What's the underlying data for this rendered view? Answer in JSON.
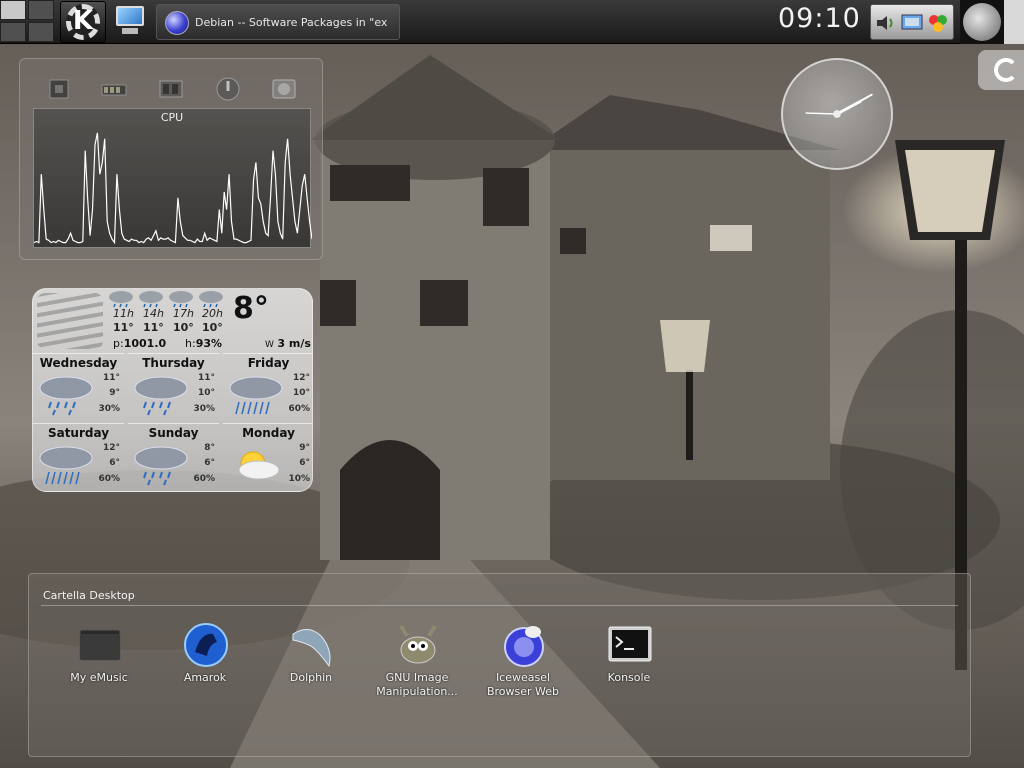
{
  "panel": {
    "taskbar_window_title": "Debian -- Software Packages in \"ex",
    "clock_time": "09:10"
  },
  "system_monitor": {
    "graph_title": "CPU",
    "cpu_samples": [
      2,
      3,
      2,
      60,
      30,
      5,
      4,
      2,
      3,
      2,
      4,
      3,
      2,
      2,
      5,
      10,
      4,
      3,
      2,
      2,
      3,
      80,
      40,
      8,
      30,
      85,
      95,
      60,
      70,
      90,
      20,
      10,
      5,
      2,
      60,
      30,
      10,
      5,
      4,
      3,
      5,
      4,
      4,
      2,
      3,
      2,
      5,
      6,
      4,
      8,
      12,
      4,
      6,
      5,
      5,
      6,
      4,
      3,
      2,
      40,
      20,
      8,
      6,
      4,
      4,
      3,
      2,
      5,
      3,
      3,
      10,
      4,
      6,
      5,
      4,
      3,
      30,
      10,
      45,
      30,
      60,
      20,
      5,
      5,
      4,
      3,
      2,
      2,
      3,
      4,
      55,
      70,
      40,
      35,
      20,
      10,
      8,
      40,
      80,
      60,
      20,
      10,
      5,
      70,
      90,
      60,
      40,
      20,
      10,
      30,
      50,
      60,
      40,
      20,
      5
    ]
  },
  "weather": {
    "current_temp": "8°",
    "hourly": [
      {
        "time": "11h",
        "temp": "11°"
      },
      {
        "time": "14h",
        "temp": "11°"
      },
      {
        "time": "17h",
        "temp": "10°"
      },
      {
        "time": "20h",
        "temp": "10°"
      }
    ],
    "pressure_label": "p:",
    "pressure": "1001.0",
    "humidity_label": "h:",
    "humidity": "93%",
    "wind_dir": "W",
    "wind_speed": "3 m/s",
    "forecast": [
      {
        "day": "Wednesday",
        "high": "11°",
        "low": "9°",
        "rain": "30%",
        "icon": "rain-cloud-icon"
      },
      {
        "day": "Thursday",
        "high": "11°",
        "low": "10°",
        "rain": "30%",
        "icon": "rain-cloud-icon"
      },
      {
        "day": "Friday",
        "high": "12°",
        "low": "10°",
        "rain": "60%",
        "icon": "heavy-rain-icon"
      },
      {
        "day": "Saturday",
        "high": "12°",
        "low": "6°",
        "rain": "60%",
        "icon": "heavy-rain-icon"
      },
      {
        "day": "Sunday",
        "high": "8°",
        "low": "6°",
        "rain": "60%",
        "icon": "rain-cloud-icon"
      },
      {
        "day": "Monday",
        "high": "9°",
        "low": "6°",
        "rain": "10%",
        "icon": "sun-cloud-icon"
      }
    ]
  },
  "folder_view": {
    "title": "Cartella Desktop",
    "items": [
      {
        "label": "My eMusic",
        "icon": "folder-icon"
      },
      {
        "label": "Amarok",
        "icon": "amarok-wolf-icon"
      },
      {
        "label": "Dolphin",
        "icon": "dolphin-icon"
      },
      {
        "label": "GNU Image Manipulation...",
        "icon": "gimp-icon"
      },
      {
        "label": "Iceweasel Browser Web",
        "icon": "iceweasel-globe-icon"
      },
      {
        "label": "Konsole",
        "icon": "terminal-icon"
      }
    ]
  },
  "colors": {
    "panel_bg": "#1a1a1a",
    "panel_text": "#f2f2f2",
    "widget_bg": "#787370"
  }
}
